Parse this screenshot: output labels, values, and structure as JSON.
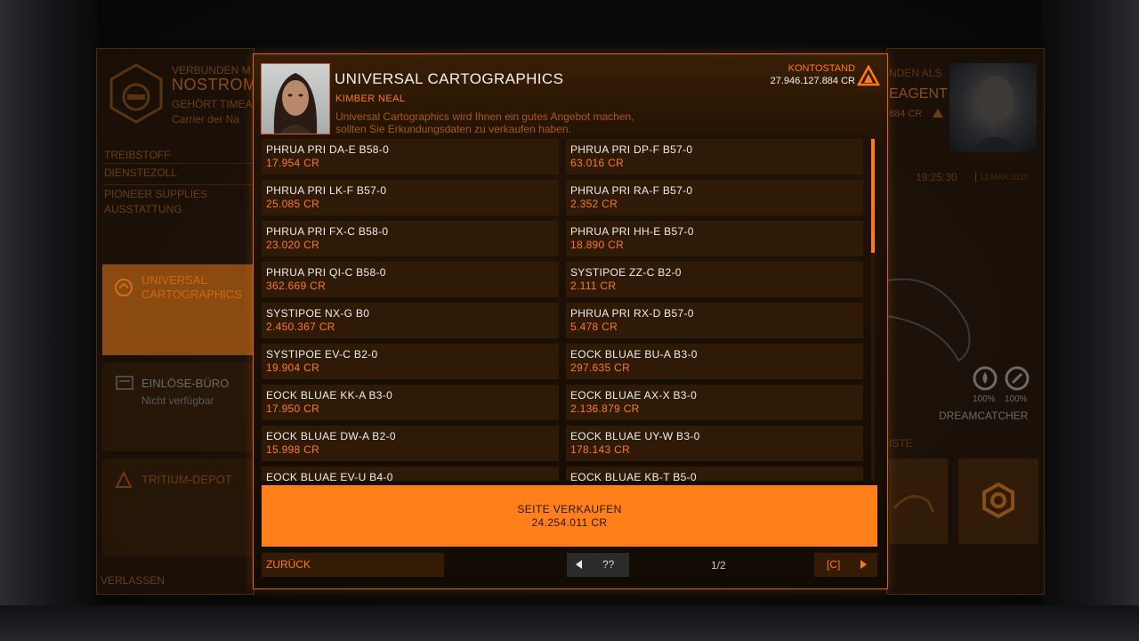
{
  "left_panel": {
    "connected_label": "VERBUNDEN M",
    "carrier_name": "NOSTROM",
    "owner_label": "GEHÖRT TIMEA",
    "carrier_type": "Carrier der Na",
    "menu": [
      "TREIBSTOFF",
      "DIENSTEZOLL",
      "PIONEER SUPPLIES",
      "AUSSTATTUNG"
    ],
    "cards": [
      {
        "title_1": "UNIVERSAL",
        "title_2": "CARTOGRAPHICS"
      },
      {
        "title": "EINLÖSE-BÜRO",
        "subtitle": "Nicht verfügbar"
      },
      {
        "title": "TRITIUM-DEPOT"
      }
    ],
    "exit_label": "VERLASSEN"
  },
  "right_panel": {
    "connected_label": "NDEN ALS",
    "commander_name": "EAGENT",
    "credits_partial": "884 CR",
    "time": "19:25:30",
    "date": "12 MAR 3310",
    "hull_percent": "100%",
    "module_percent": "100%",
    "ship_name": "DREAMCATCHER",
    "list_label": "ISTE"
  },
  "header": {
    "station": "UNIVERSAL CARTOGRAPHICS",
    "contact": "KIMBER NEAL",
    "offer_line_1": "Universal Cartographics wird Ihnen ein gutes Angebot machen,",
    "offer_line_2": "sollten Sie Erkundungsdaten zu verkaufen haben.",
    "balance_label": "KONTOSTAND",
    "balance_value": "27.946.127.884 CR"
  },
  "systems": [
    {
      "name": "PHRUA PRI DA-E B58-0",
      "value": "17.954 CR"
    },
    {
      "name": "PHRUA PRI DP-F B57-0",
      "value": "63.016 CR"
    },
    {
      "name": "PHRUA PRI LK-F B57-0",
      "value": "25.085 CR"
    },
    {
      "name": "PHRUA PRI RA-F B57-0",
      "value": "2.352 CR"
    },
    {
      "name": "PHRUA PRI FX-C B58-0",
      "value": "23.020 CR"
    },
    {
      "name": "PHRUA PRI HH-E B57-0",
      "value": "18.890 CR"
    },
    {
      "name": "PHRUA PRI QI-C B58-0",
      "value": "362.669 CR"
    },
    {
      "name": "SYSTIPOE ZZ-C B2-0",
      "value": "2.111 CR"
    },
    {
      "name": "SYSTIPOE NX-G B0",
      "value": "2.450.367 CR"
    },
    {
      "name": "PHRUA PRI RX-D B57-0",
      "value": "5.478 CR"
    },
    {
      "name": "SYSTIPOE EV-C B2-0",
      "value": "19.904 CR"
    },
    {
      "name": "EOCK BLUAE BU-A B3-0",
      "value": "297.635 CR"
    },
    {
      "name": "EOCK BLUAE KK-A B3-0",
      "value": "17.950 CR"
    },
    {
      "name": "EOCK BLUAE AX-X B3-0",
      "value": "2.136.879 CR"
    },
    {
      "name": "EOCK BLUAE DW-A B2-0",
      "value": "15.998 CR"
    },
    {
      "name": "EOCK BLUAE UY-W B3-0",
      "value": "178.143 CR"
    },
    {
      "name": "EOCK BLUAE EV-U B4-0",
      "value": ""
    },
    {
      "name": "EOCK BLUAE KB-T B5-0",
      "value": ""
    }
  ],
  "sell": {
    "label": "SEITE VERKAUFEN",
    "value": "24.254.011 CR"
  },
  "footer": {
    "back": "ZURÜCK",
    "prev_key": "??",
    "page": "1/2",
    "next_key": "[C]"
  },
  "colors": {
    "accent": "#ff7f1b",
    "cell_bg": "#2f1a07",
    "text_light": "#eeeeee"
  }
}
